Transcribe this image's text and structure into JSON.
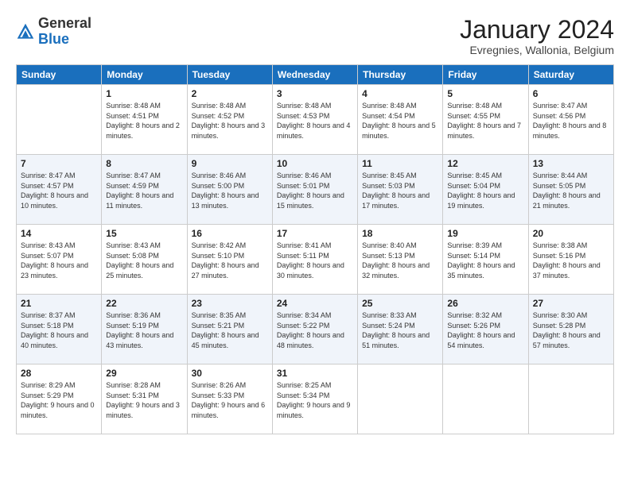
{
  "logo": {
    "general": "General",
    "blue": "Blue"
  },
  "header": {
    "month": "January 2024",
    "location": "Evregnies, Wallonia, Belgium"
  },
  "weekdays": [
    "Sunday",
    "Monday",
    "Tuesday",
    "Wednesday",
    "Thursday",
    "Friday",
    "Saturday"
  ],
  "weeks": [
    [
      {
        "day": "",
        "sunrise": "",
        "sunset": "",
        "daylight": ""
      },
      {
        "day": "1",
        "sunrise": "Sunrise: 8:48 AM",
        "sunset": "Sunset: 4:51 PM",
        "daylight": "Daylight: 8 hours and 2 minutes."
      },
      {
        "day": "2",
        "sunrise": "Sunrise: 8:48 AM",
        "sunset": "Sunset: 4:52 PM",
        "daylight": "Daylight: 8 hours and 3 minutes."
      },
      {
        "day": "3",
        "sunrise": "Sunrise: 8:48 AM",
        "sunset": "Sunset: 4:53 PM",
        "daylight": "Daylight: 8 hours and 4 minutes."
      },
      {
        "day": "4",
        "sunrise": "Sunrise: 8:48 AM",
        "sunset": "Sunset: 4:54 PM",
        "daylight": "Daylight: 8 hours and 5 minutes."
      },
      {
        "day": "5",
        "sunrise": "Sunrise: 8:48 AM",
        "sunset": "Sunset: 4:55 PM",
        "daylight": "Daylight: 8 hours and 7 minutes."
      },
      {
        "day": "6",
        "sunrise": "Sunrise: 8:47 AM",
        "sunset": "Sunset: 4:56 PM",
        "daylight": "Daylight: 8 hours and 8 minutes."
      }
    ],
    [
      {
        "day": "7",
        "sunrise": "Sunrise: 8:47 AM",
        "sunset": "Sunset: 4:57 PM",
        "daylight": "Daylight: 8 hours and 10 minutes."
      },
      {
        "day": "8",
        "sunrise": "Sunrise: 8:47 AM",
        "sunset": "Sunset: 4:59 PM",
        "daylight": "Daylight: 8 hours and 11 minutes."
      },
      {
        "day": "9",
        "sunrise": "Sunrise: 8:46 AM",
        "sunset": "Sunset: 5:00 PM",
        "daylight": "Daylight: 8 hours and 13 minutes."
      },
      {
        "day": "10",
        "sunrise": "Sunrise: 8:46 AM",
        "sunset": "Sunset: 5:01 PM",
        "daylight": "Daylight: 8 hours and 15 minutes."
      },
      {
        "day": "11",
        "sunrise": "Sunrise: 8:45 AM",
        "sunset": "Sunset: 5:03 PM",
        "daylight": "Daylight: 8 hours and 17 minutes."
      },
      {
        "day": "12",
        "sunrise": "Sunrise: 8:45 AM",
        "sunset": "Sunset: 5:04 PM",
        "daylight": "Daylight: 8 hours and 19 minutes."
      },
      {
        "day": "13",
        "sunrise": "Sunrise: 8:44 AM",
        "sunset": "Sunset: 5:05 PM",
        "daylight": "Daylight: 8 hours and 21 minutes."
      }
    ],
    [
      {
        "day": "14",
        "sunrise": "Sunrise: 8:43 AM",
        "sunset": "Sunset: 5:07 PM",
        "daylight": "Daylight: 8 hours and 23 minutes."
      },
      {
        "day": "15",
        "sunrise": "Sunrise: 8:43 AM",
        "sunset": "Sunset: 5:08 PM",
        "daylight": "Daylight: 8 hours and 25 minutes."
      },
      {
        "day": "16",
        "sunrise": "Sunrise: 8:42 AM",
        "sunset": "Sunset: 5:10 PM",
        "daylight": "Daylight: 8 hours and 27 minutes."
      },
      {
        "day": "17",
        "sunrise": "Sunrise: 8:41 AM",
        "sunset": "Sunset: 5:11 PM",
        "daylight": "Daylight: 8 hours and 30 minutes."
      },
      {
        "day": "18",
        "sunrise": "Sunrise: 8:40 AM",
        "sunset": "Sunset: 5:13 PM",
        "daylight": "Daylight: 8 hours and 32 minutes."
      },
      {
        "day": "19",
        "sunrise": "Sunrise: 8:39 AM",
        "sunset": "Sunset: 5:14 PM",
        "daylight": "Daylight: 8 hours and 35 minutes."
      },
      {
        "day": "20",
        "sunrise": "Sunrise: 8:38 AM",
        "sunset": "Sunset: 5:16 PM",
        "daylight": "Daylight: 8 hours and 37 minutes."
      }
    ],
    [
      {
        "day": "21",
        "sunrise": "Sunrise: 8:37 AM",
        "sunset": "Sunset: 5:18 PM",
        "daylight": "Daylight: 8 hours and 40 minutes."
      },
      {
        "day": "22",
        "sunrise": "Sunrise: 8:36 AM",
        "sunset": "Sunset: 5:19 PM",
        "daylight": "Daylight: 8 hours and 43 minutes."
      },
      {
        "day": "23",
        "sunrise": "Sunrise: 8:35 AM",
        "sunset": "Sunset: 5:21 PM",
        "daylight": "Daylight: 8 hours and 45 minutes."
      },
      {
        "day": "24",
        "sunrise": "Sunrise: 8:34 AM",
        "sunset": "Sunset: 5:22 PM",
        "daylight": "Daylight: 8 hours and 48 minutes."
      },
      {
        "day": "25",
        "sunrise": "Sunrise: 8:33 AM",
        "sunset": "Sunset: 5:24 PM",
        "daylight": "Daylight: 8 hours and 51 minutes."
      },
      {
        "day": "26",
        "sunrise": "Sunrise: 8:32 AM",
        "sunset": "Sunset: 5:26 PM",
        "daylight": "Daylight: 8 hours and 54 minutes."
      },
      {
        "day": "27",
        "sunrise": "Sunrise: 8:30 AM",
        "sunset": "Sunset: 5:28 PM",
        "daylight": "Daylight: 8 hours and 57 minutes."
      }
    ],
    [
      {
        "day": "28",
        "sunrise": "Sunrise: 8:29 AM",
        "sunset": "Sunset: 5:29 PM",
        "daylight": "Daylight: 9 hours and 0 minutes."
      },
      {
        "day": "29",
        "sunrise": "Sunrise: 8:28 AM",
        "sunset": "Sunset: 5:31 PM",
        "daylight": "Daylight: 9 hours and 3 minutes."
      },
      {
        "day": "30",
        "sunrise": "Sunrise: 8:26 AM",
        "sunset": "Sunset: 5:33 PM",
        "daylight": "Daylight: 9 hours and 6 minutes."
      },
      {
        "day": "31",
        "sunrise": "Sunrise: 8:25 AM",
        "sunset": "Sunset: 5:34 PM",
        "daylight": "Daylight: 9 hours and 9 minutes."
      },
      {
        "day": "",
        "sunrise": "",
        "sunset": "",
        "daylight": ""
      },
      {
        "day": "",
        "sunrise": "",
        "sunset": "",
        "daylight": ""
      },
      {
        "day": "",
        "sunrise": "",
        "sunset": "",
        "daylight": ""
      }
    ]
  ]
}
